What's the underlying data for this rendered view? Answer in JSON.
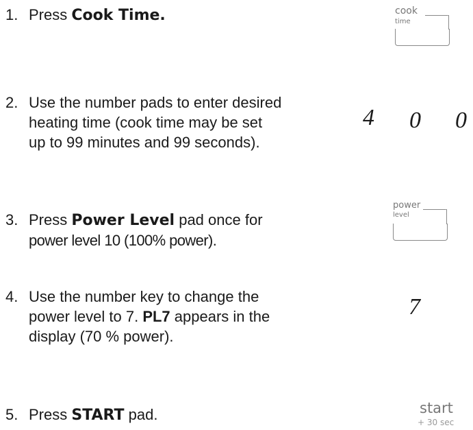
{
  "steps": [
    {
      "num": "1.",
      "pre": "Press ",
      "key": "Cook Time.",
      "post": ""
    },
    {
      "num": "2.",
      "lines": [
        "Use the number pads to enter desired",
        "heating time (cook time may be set",
        "up to 99 minutes and 99 seconds)."
      ]
    },
    {
      "num": "3.",
      "pre": "Press ",
      "key": "Power Level",
      "post": " pad once for",
      "line2": "power level 10 (100% power)."
    },
    {
      "num": "4.",
      "line1": "Use the number key to change the",
      "line2_pre": "power level to 7. ",
      "line2_bold": "PL7",
      "line2_post": " appears in the",
      "line3": "display (70 % power)."
    },
    {
      "num": "5.",
      "pre": "Press ",
      "key": "START",
      "post": " pad."
    }
  ],
  "pads": {
    "cook_time": {
      "word1": "cook",
      "word2": "time"
    },
    "power_level": {
      "word1": "power",
      "word2": "level"
    },
    "start": {
      "word1": "start",
      "word2": "+ 30 sec"
    }
  },
  "digits": {
    "time": [
      "4",
      "0",
      "0"
    ],
    "power": "7"
  }
}
